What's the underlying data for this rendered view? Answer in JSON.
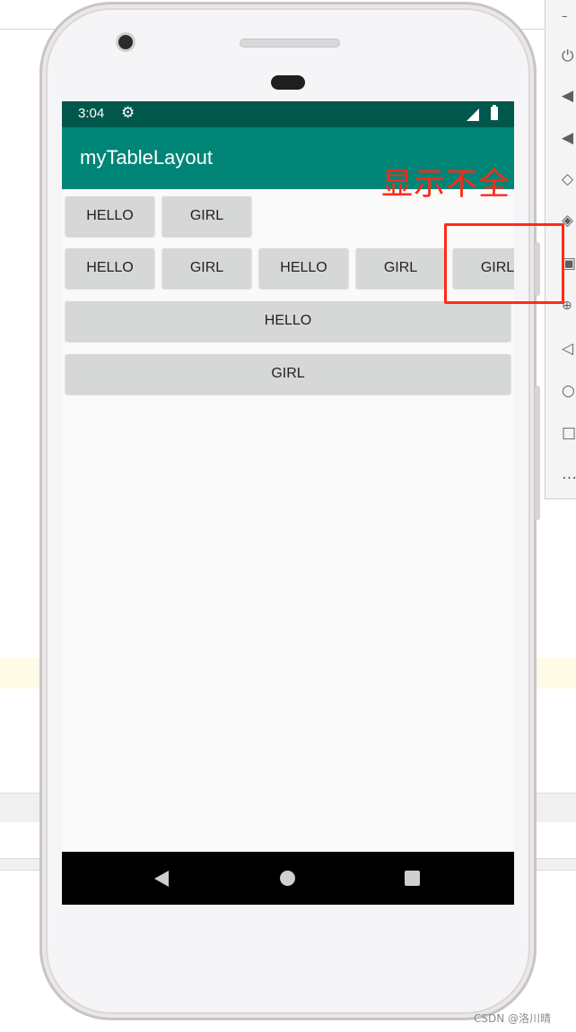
{
  "status_bar": {
    "time": "3:04",
    "icons": [
      "gear-icon",
      "signal-icon",
      "battery-icon"
    ]
  },
  "app_bar": {
    "title": "myTableLayout"
  },
  "table": {
    "row1": [
      "HELLO",
      "GIRL"
    ],
    "row2": [
      "HELLO",
      "GIRL",
      "HELLO",
      "GIRL",
      "GIRL"
    ],
    "row3": "HELLO",
    "row4": "GIRL"
  },
  "nav_bar": {
    "icons": [
      "back-icon",
      "home-icon",
      "recents-icon"
    ]
  },
  "annotation": {
    "text": "显示不全",
    "color": "#ff2a1a"
  },
  "emulator_toolbar": {
    "icons": [
      "minimize-icon",
      "power-icon",
      "volume-up-icon",
      "volume-down-icon",
      "rotate-left-icon",
      "rotate-right-icon",
      "camera-icon",
      "zoom-icon",
      "back-icon",
      "home-icon",
      "overview-icon",
      "more-icon"
    ]
  },
  "watermark": "CSDN @洛川晴",
  "colors": {
    "status_bar": "#00574b",
    "app_bar": "#008577",
    "button": "#d6d7d7"
  }
}
